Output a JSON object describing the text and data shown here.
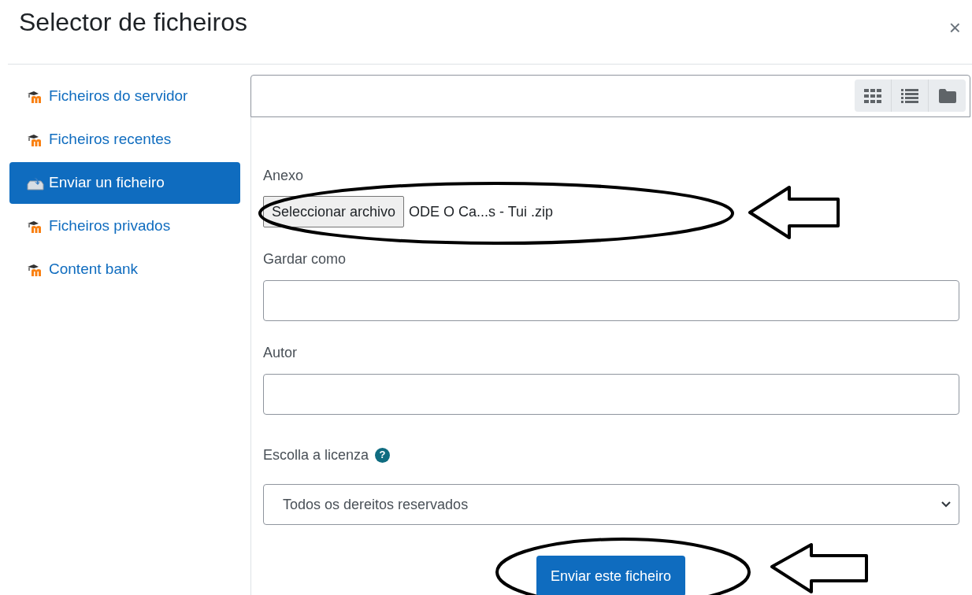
{
  "dialog": {
    "title": "Selector de ficheiros",
    "close": "×"
  },
  "sidebar": {
    "items": [
      {
        "label": "Ficheiros do servidor",
        "kind": "repository",
        "selected": false
      },
      {
        "label": "Ficheiros recentes",
        "kind": "repository",
        "selected": false
      },
      {
        "label": "Enviar un ficheiro",
        "kind": "upload",
        "selected": true
      },
      {
        "label": "Ficheiros privados",
        "kind": "repository",
        "selected": false
      },
      {
        "label": "Content bank",
        "kind": "repository",
        "selected": false
      }
    ]
  },
  "form": {
    "attachment": {
      "label": "Anexo",
      "button": "Seleccionar archivo",
      "file_name": "ODE O Ca...s - Tui .zip"
    },
    "save_as": {
      "label": "Gardar como"
    },
    "author": {
      "label": "Autor"
    },
    "license": {
      "label": "Escolla a licenza",
      "help": "?",
      "value": "Todos os dereitos reservados"
    },
    "submit": "Enviar este ficheiro"
  }
}
